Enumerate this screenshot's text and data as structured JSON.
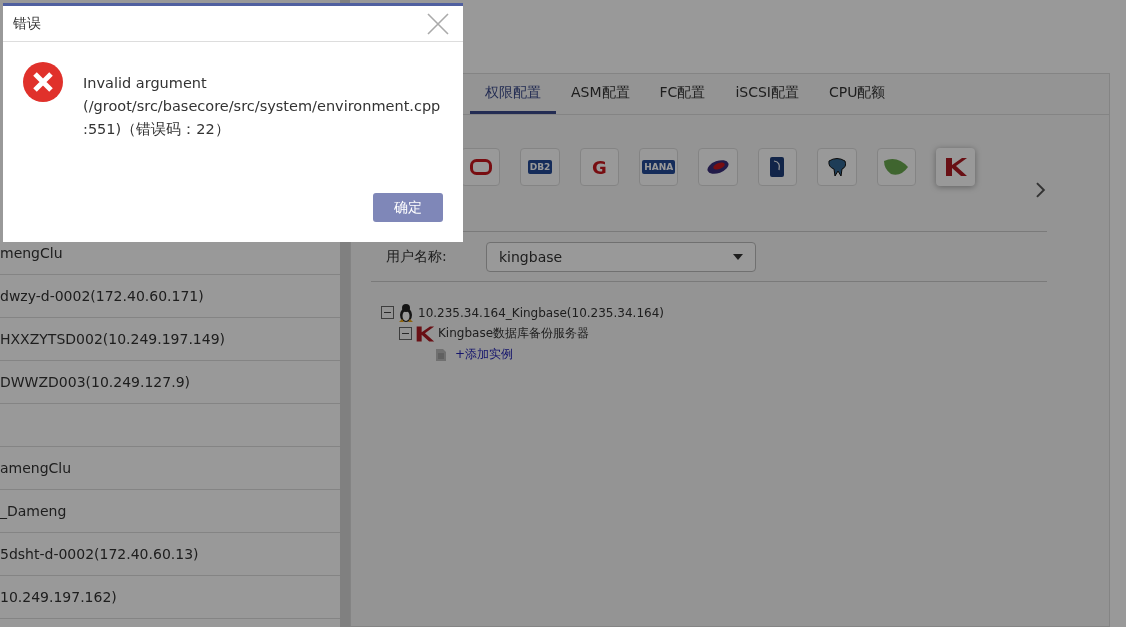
{
  "host_groups": [
    {
      "items": [
        "mengClu",
        "dwzy-d-0002(172.40.60.171)",
        "HXXZYTSD002(10.249.197.149)",
        "DWWZD003(10.249.127.9)"
      ]
    },
    {
      "items": [
        "amengClu",
        "_Dameng",
        "5dsht-d-0002(172.40.60.13)",
        "10.249.197.162)"
      ]
    }
  ],
  "tabs": [
    {
      "label": "权限配置",
      "selected": true
    },
    {
      "label": "ASM配置",
      "selected": false
    },
    {
      "label": "FC配置",
      "selected": false
    },
    {
      "label": "iSCSI配置",
      "selected": false
    },
    {
      "label": "CPU配额",
      "selected": false
    }
  ],
  "db_icons": [
    {
      "kind": "ring",
      "selected": false
    },
    {
      "kind": "badge",
      "text": "DB2",
      "selected": false
    },
    {
      "kind": "letter",
      "text": "G",
      "selected": false
    },
    {
      "kind": "badge",
      "text": "HANA",
      "selected": false
    },
    {
      "kind": "ellipse",
      "selected": false
    },
    {
      "kind": "card",
      "selected": false
    },
    {
      "kind": "elephant",
      "selected": false
    },
    {
      "kind": "leaf",
      "selected": false
    },
    {
      "kind": "k",
      "selected": true
    }
  ],
  "user_name": {
    "label": "用户名称:",
    "value": "kingbase"
  },
  "tree": [
    {
      "kind": "host",
      "label": "10.235.34.164_Kingbase(10.235.34.164)",
      "expanded": true,
      "children": [
        {
          "kind": "server",
          "label": "Kingbase数据库备份服务器",
          "expanded": true,
          "children": [
            {
              "kind": "add",
              "label": "+添加实例"
            }
          ]
        }
      ]
    }
  ],
  "dialog": {
    "title": "错误",
    "message_lines": [
      "Invalid argument",
      "(/groot/src/basecore/src/system/environment.cpp",
      ":551)（错误码：22）"
    ],
    "confirm_button": "确定"
  }
}
